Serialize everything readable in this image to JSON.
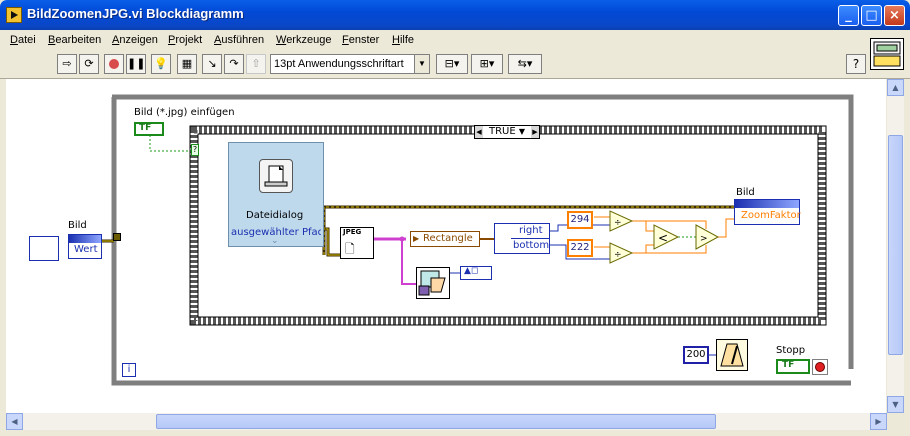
{
  "window": {
    "title": "BildZoomenJPG.vi Blockdiagramm",
    "buttons": {
      "minimize": "_",
      "maximize": "□",
      "close": "×"
    }
  },
  "menu": [
    "Datei",
    "Bearbeiten",
    "Anzeigen",
    "Projekt",
    "Ausführen",
    "Werkzeuge",
    "Fenster",
    "Hilfe"
  ],
  "toolbar": {
    "font": "13pt Anwendungsschriftart",
    "help": "?"
  },
  "diagram": {
    "bool_control_label": "Bild (*.jpg) einfügen",
    "case_selector": "TRUE",
    "image_label_left": "Bild",
    "bundle_field": "Wert",
    "file_dialog_title": "Dateidialog",
    "file_dialog_output": "ausgewählter Pfad",
    "jpeg_label": "JPEG",
    "rectangle_label": "Rectangle",
    "unbundle_right": "right",
    "unbundle_bottom": "bottom",
    "const_294": "294",
    "const_222": "222",
    "image_label_right": "Bild",
    "zoom_factor": "ZoomFaktor",
    "const_200": "200",
    "stop_label": "Stopp",
    "tf": "TF",
    "iteration": "i"
  }
}
